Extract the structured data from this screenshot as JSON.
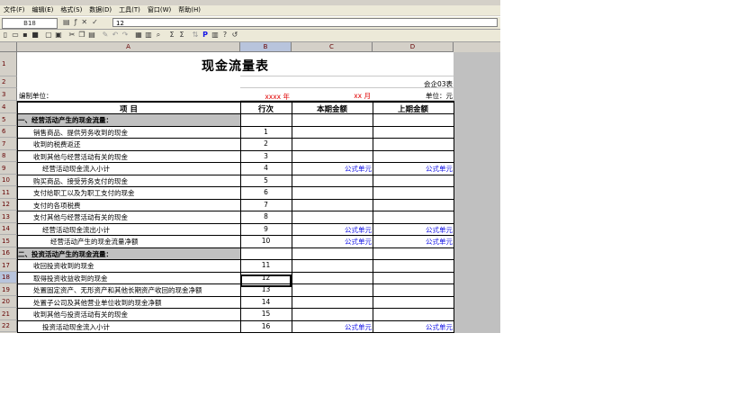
{
  "menu": [
    "文件(F)",
    "编辑(E)",
    "格式(S)",
    "数据(D)",
    "工具(T)",
    "窗口(W)",
    "帮助(H)"
  ],
  "formula_bar": {
    "cell_ref": "B18",
    "value": "12"
  },
  "columns": [
    "A",
    "B",
    "C",
    "D"
  ],
  "sheet": {
    "title": "现金流量表",
    "form_code": "会企03表",
    "unit_label": "编制单位：",
    "year": "xxxx 年",
    "month": "xx 月",
    "currency": "单位：元",
    "headers": {
      "item": "项          目",
      "line": "行次",
      "current": "本期金额",
      "prior": "上期金额"
    }
  },
  "rows": [
    {
      "n": "1",
      "item": "",
      "line": "",
      "current": "",
      "prior": ""
    },
    {
      "n": "2",
      "item": "",
      "line": "",
      "current": "",
      "prior": ""
    },
    {
      "n": "3",
      "item": "",
      "line": "",
      "current": "",
      "prior": ""
    },
    {
      "n": "4",
      "item": "",
      "line": "",
      "current": "",
      "prior": ""
    },
    {
      "n": "5",
      "item": "一、经营活动产生的现金流量：",
      "line": "",
      "current": "",
      "prior": ""
    },
    {
      "n": "6",
      "item": "销售商品、提供劳务收到的现金",
      "line": "1",
      "current": "",
      "prior": ""
    },
    {
      "n": "7",
      "item": "收到的税费返还",
      "line": "2",
      "current": "",
      "prior": ""
    },
    {
      "n": "8",
      "item": "收到其他与经营活动有关的现金",
      "line": "3",
      "current": "",
      "prior": ""
    },
    {
      "n": "9",
      "item": "经营活动现金流入小计",
      "line": "4",
      "current": "公式单元",
      "prior": "公式单元"
    },
    {
      "n": "10",
      "item": "购买商品、接受劳务支付的现金",
      "line": "5",
      "current": "",
      "prior": ""
    },
    {
      "n": "11",
      "item": "支付给职工以及为职工支付的现金",
      "line": "6",
      "current": "",
      "prior": ""
    },
    {
      "n": "12",
      "item": "支付的各项税费",
      "line": "7",
      "current": "",
      "prior": ""
    },
    {
      "n": "13",
      "item": "支付其他与经营活动有关的现金",
      "line": "8",
      "current": "",
      "prior": ""
    },
    {
      "n": "14",
      "item": "经营活动现金流出小计",
      "line": "9",
      "current": "公式单元",
      "prior": "公式单元"
    },
    {
      "n": "15",
      "item": "经营活动产生的现金流量净额",
      "line": "10",
      "current": "公式单元",
      "prior": "公式单元"
    },
    {
      "n": "16",
      "item": "二、投资活动产生的现金流量：",
      "line": "",
      "current": "",
      "prior": ""
    },
    {
      "n": "17",
      "item": "收回投资收到的现金",
      "line": "11",
      "current": "",
      "prior": ""
    },
    {
      "n": "18",
      "item": "取得投资收益收到的现金",
      "line": "12",
      "current": "",
      "prior": ""
    },
    {
      "n": "19",
      "item": "处置固定资产、无形资产和其他长期资产收回的现金净额",
      "line": "13",
      "current": "",
      "prior": ""
    },
    {
      "n": "20",
      "item": "处置子公司及其他营业单位收到的现金净额",
      "line": "14",
      "current": "",
      "prior": ""
    },
    {
      "n": "21",
      "item": "收到其他与投资活动有关的现金",
      "line": "15",
      "current": "",
      "prior": ""
    },
    {
      "n": "22",
      "item": "投资活动现金流入小计",
      "line": "16",
      "current": "公式单元",
      "prior": "公式单元"
    }
  ]
}
